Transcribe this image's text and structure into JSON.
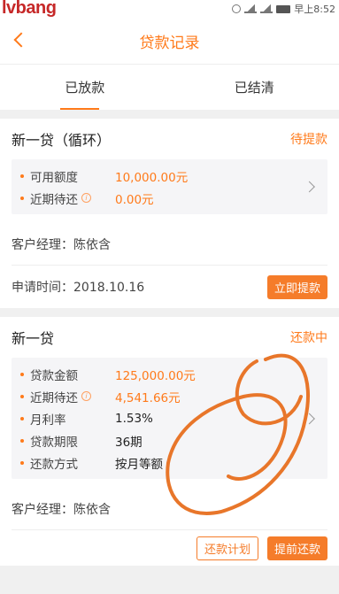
{
  "watermark": "lvbang",
  "statusbar": {
    "time": "早上8:52"
  },
  "header": {
    "title": "贷款记录"
  },
  "tabs": [
    {
      "label": "已放款",
      "active": true
    },
    {
      "label": "已结清",
      "active": false
    }
  ],
  "loans": [
    {
      "title": "新一贷（循环）",
      "status": "待提款",
      "details": [
        {
          "label": "可用额度",
          "value": "10,000.00元",
          "info": false,
          "color": "orange"
        },
        {
          "label": "近期待还",
          "value": "0.00元",
          "info": true,
          "color": "orange"
        }
      ],
      "manager": "客户经理：陈依含",
      "apply_time": "申请时间：2018.10.16",
      "action": "立即提款"
    },
    {
      "title": "新一贷",
      "status": "还款中",
      "details": [
        {
          "label": "贷款金额",
          "value": "125,000.00元",
          "info": false,
          "color": "orange"
        },
        {
          "label": "近期待还",
          "value": "4,541.66元",
          "info": true,
          "color": "orange"
        },
        {
          "label": "月利率",
          "value": "1.53%",
          "info": false,
          "color": "dark"
        },
        {
          "label": "贷款期限",
          "value": "36期",
          "info": false,
          "color": "dark"
        },
        {
          "label": "还款方式",
          "value": "按月等额",
          "info": false,
          "color": "dark"
        }
      ],
      "manager": "客户经理：陈依含",
      "actions": [
        "还款计划",
        "提前还款"
      ]
    }
  ],
  "colors": {
    "accent": "#ff7a1a",
    "button": "#f57c2a",
    "scribble": "#e8762a"
  }
}
